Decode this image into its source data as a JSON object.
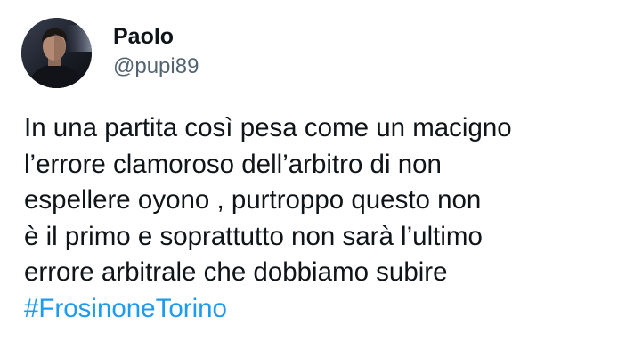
{
  "tweet": {
    "author": {
      "display_name": "Paolo",
      "handle": "@pupi89",
      "avatar_icon": "user-avatar-photo"
    },
    "body_lines": [
      "In una partita così pesa come un macigno",
      "l’errore clamoroso dell’arbitro di non",
      "espellere oyono , purtroppo questo non",
      "è il primo e soprattutto non sarà l’ultimo",
      "errore arbitrale che dobbiamo subire"
    ],
    "hashtag": "#FrosinoneTorino"
  },
  "colors": {
    "text": "#0f1419",
    "secondary": "#536471",
    "link": "#1d9bf0",
    "background": "#ffffff"
  }
}
